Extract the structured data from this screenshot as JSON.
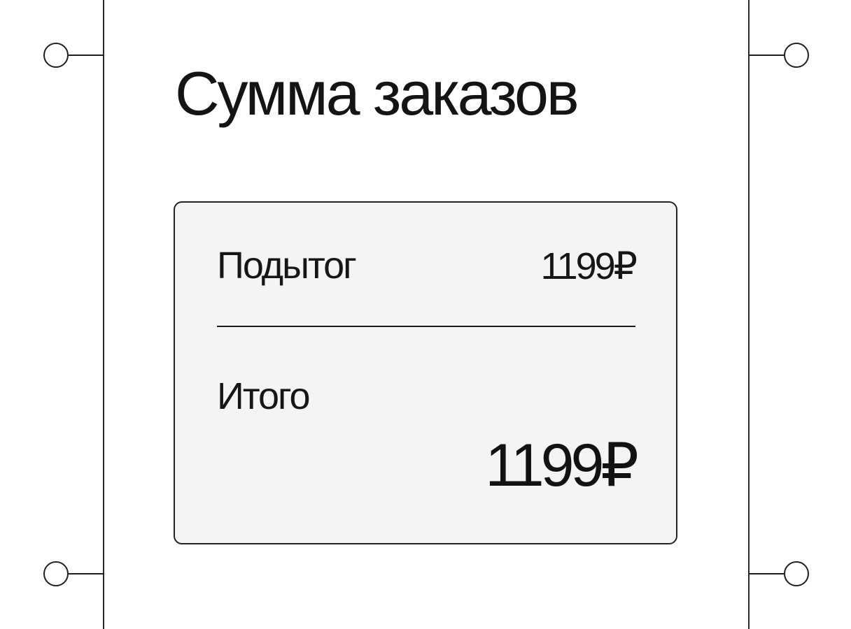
{
  "header": {
    "title": "Сумма заказов"
  },
  "summary": {
    "subtotal_label": "Подытог",
    "subtotal_value": "1199₽",
    "total_label": "Итого",
    "total_value": "1199₽"
  },
  "colors": {
    "ink": "#1a1a1a",
    "card_background": "#f4f4f4",
    "page_background": "#ffffff"
  }
}
